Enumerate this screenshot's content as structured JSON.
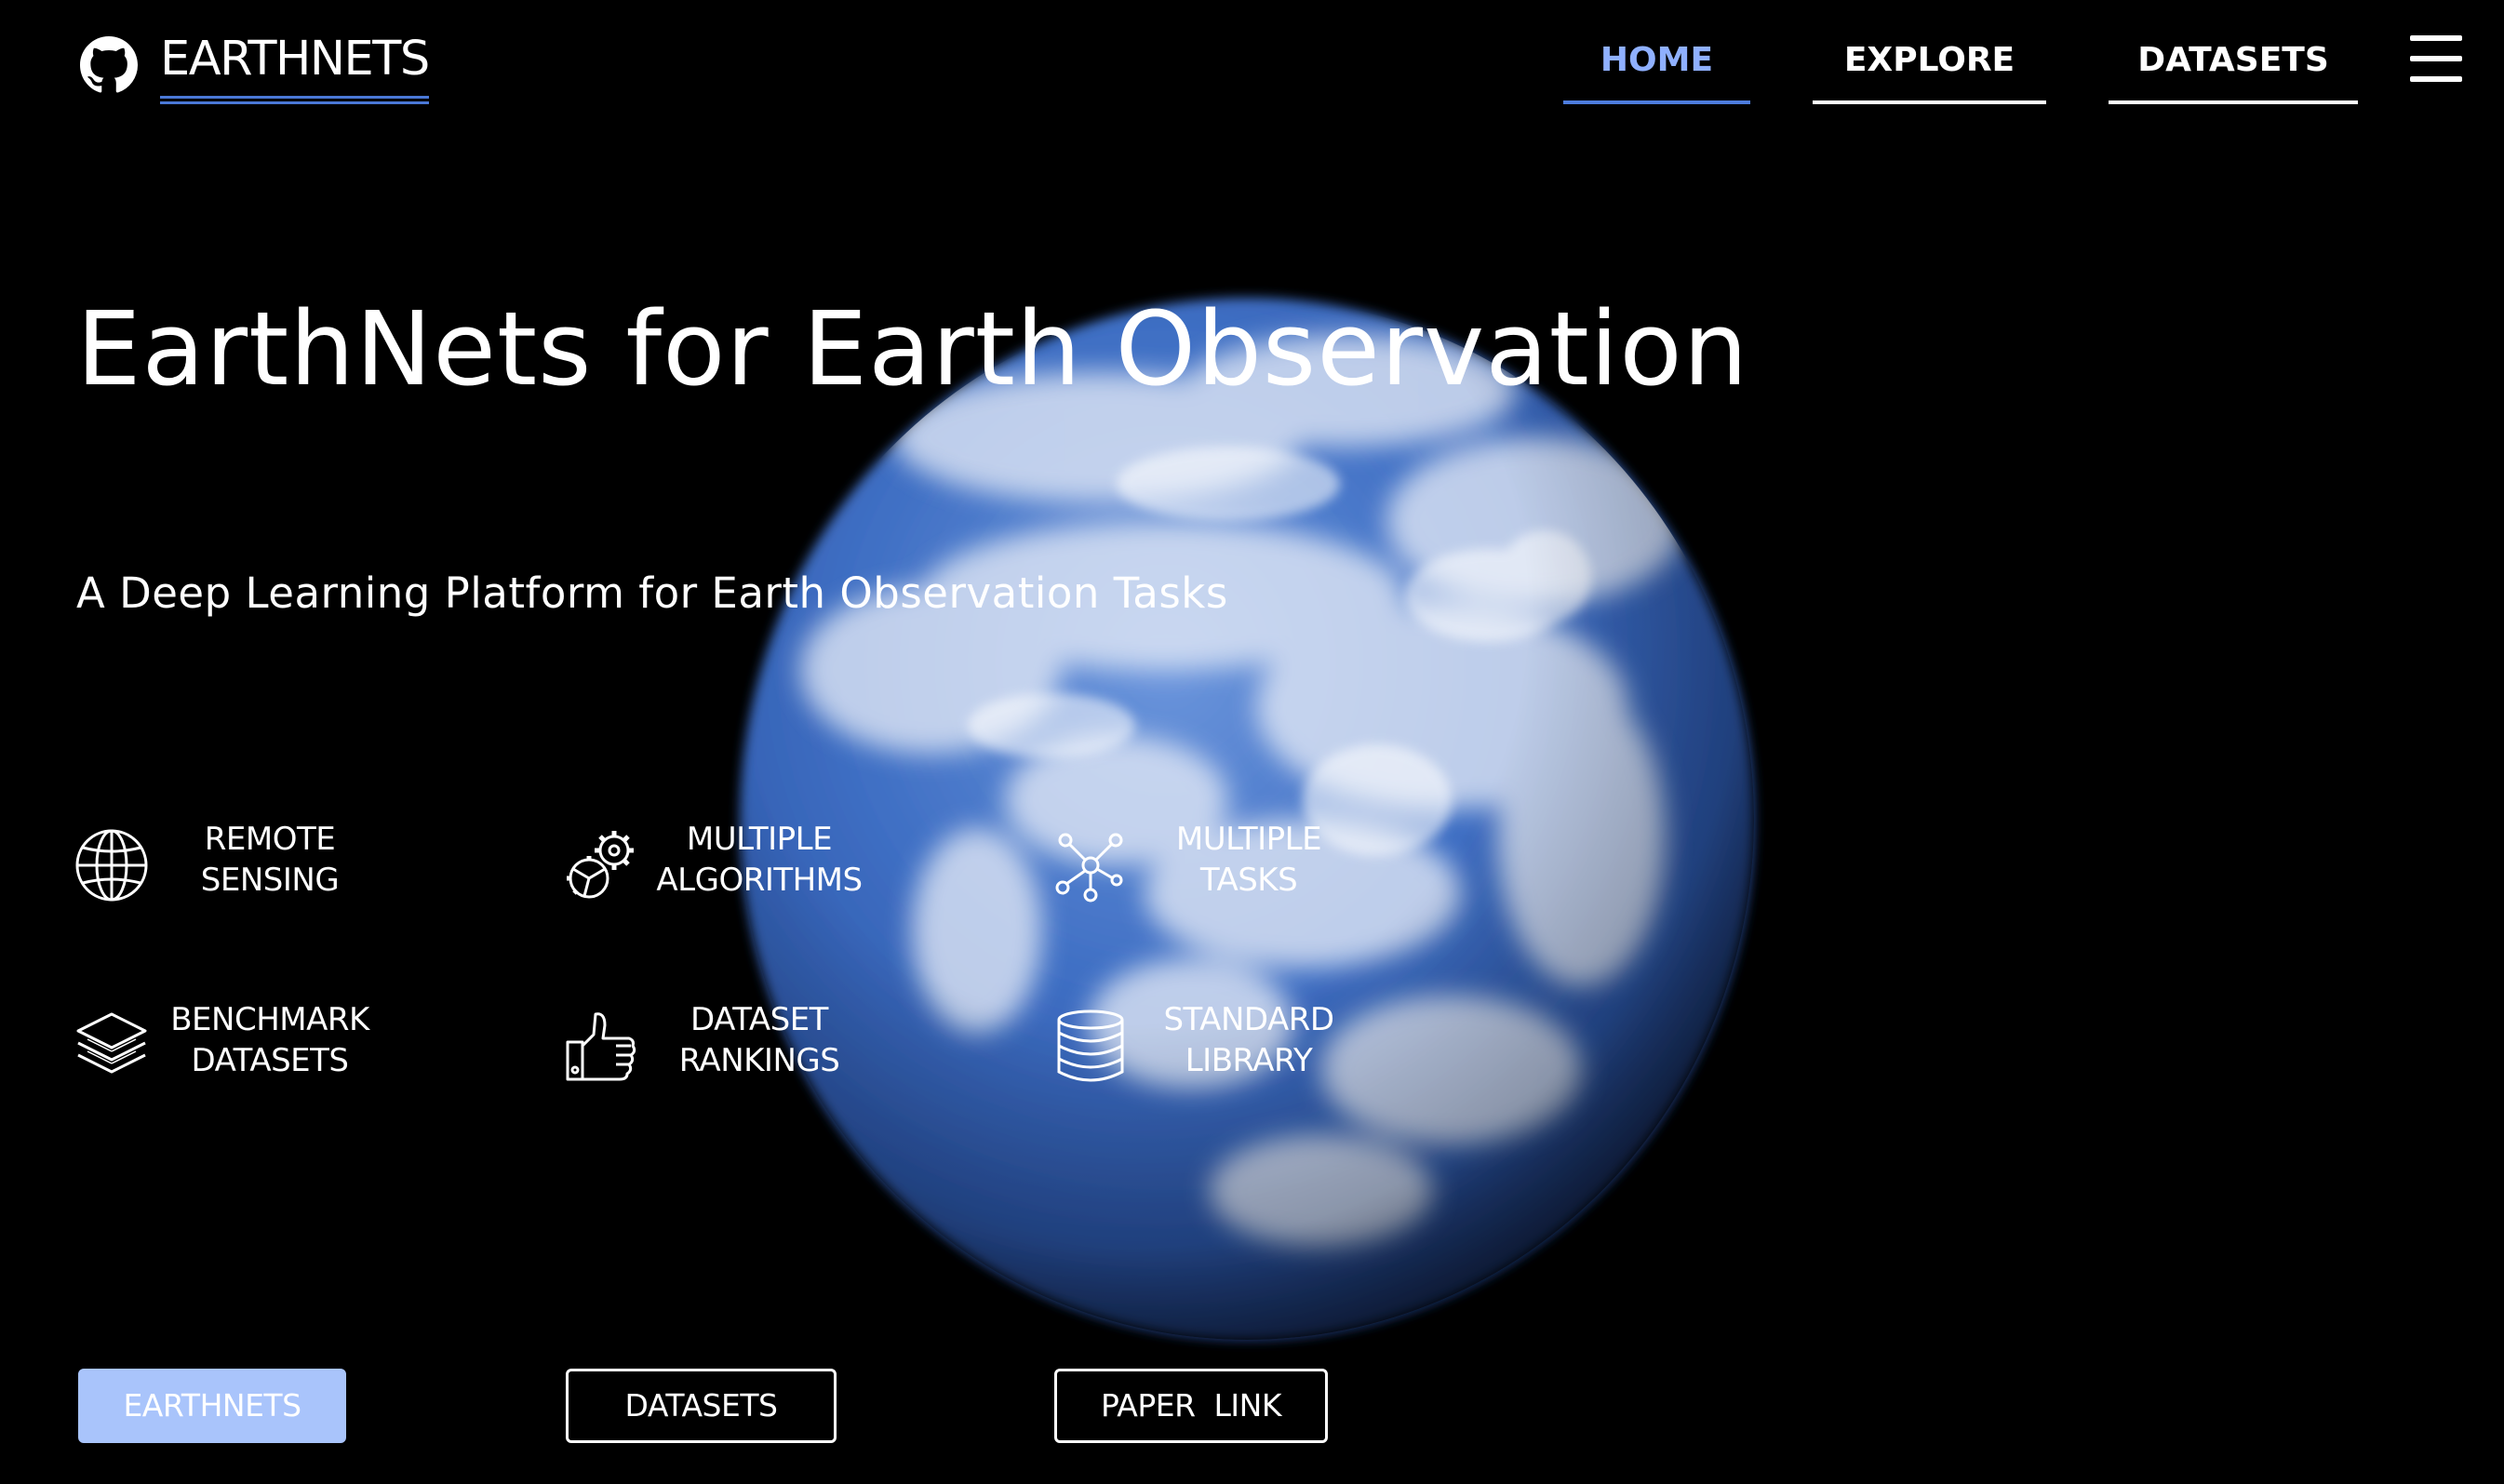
{
  "brand": {
    "name": "EARTHNETS",
    "icon": "github-icon"
  },
  "nav": {
    "items": [
      {
        "label": "HOME",
        "active": true
      },
      {
        "label": "EXPLORE",
        "active": false
      },
      {
        "label": "DATASETS",
        "active": false
      }
    ],
    "menu_icon": "hamburger-menu-icon",
    "active_color": "#8fb0ff",
    "underline_color": "#4d7cdd"
  },
  "hero": {
    "title": "EarthNets for Earth Observation",
    "subtitle": "A Deep Learning Platform for Earth Observation Tasks"
  },
  "features": [
    {
      "icon": "globe-icon",
      "line1": "REMOTE",
      "line2": "SENSING"
    },
    {
      "icon": "gears-icon",
      "line1": "MULTIPLE",
      "line2": "ALGORITHMS"
    },
    {
      "icon": "network-icon",
      "line1": "MULTIPLE",
      "line2": "TASKS"
    },
    {
      "icon": "layers-icon",
      "line1": "BENCHMARK",
      "line2": "DATASETS"
    },
    {
      "icon": "thumbs-up-icon",
      "line1": "DATASET",
      "line2": "RANKINGS"
    },
    {
      "icon": "database-icon",
      "line1": "STANDARD",
      "line2": "LIBRARY"
    }
  ],
  "buttons": {
    "earthnets": "EARTHNETS",
    "datasets": "DATASETS",
    "paper": "PAPER  LINK"
  },
  "colors": {
    "background": "#000000",
    "accent": "#4a78d6",
    "primary_button": "#a9c4fb",
    "earth_ocean": "#3f6fc4"
  }
}
